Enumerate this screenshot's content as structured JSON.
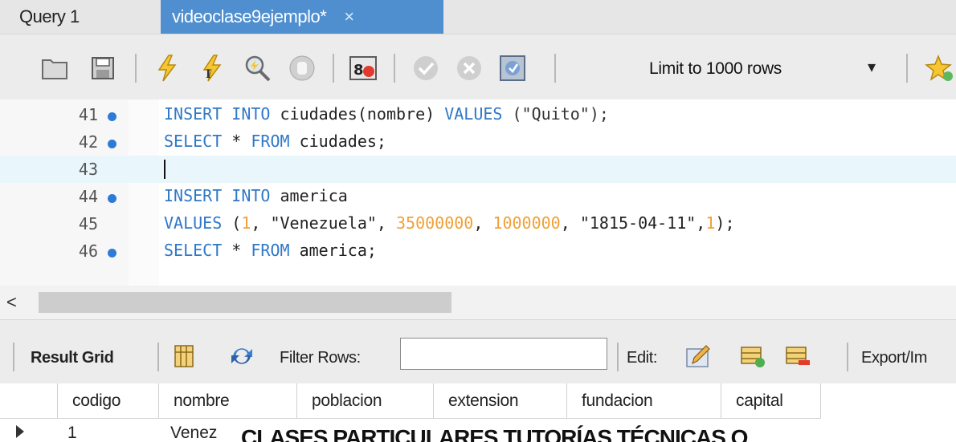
{
  "tabs": [
    {
      "label": "Query 1",
      "active": false
    },
    {
      "label": "videoclase9ejemplo*",
      "active": true
    }
  ],
  "tab_close": "×",
  "toolbar": {
    "limit_label": "Limit to 1000 rows",
    "limit_arrow": "▾"
  },
  "editor": {
    "lines": [
      {
        "num": "41",
        "dot": true
      },
      {
        "num": "42",
        "dot": true
      },
      {
        "num": "43",
        "dot": false
      },
      {
        "num": "44",
        "dot": true
      },
      {
        "num": "45",
        "dot": false
      },
      {
        "num": "46",
        "dot": true
      }
    ],
    "code": {
      "l41a": "INSERT INTO",
      "l41b": " ciudades(nombre) ",
      "l41c": "VALUES",
      "l41d": " (\"Quito\");",
      "l42a": "SELECT",
      "l42b": " * ",
      "l42c": "FROM",
      "l42d": " ciudades;",
      "l44a": "INSERT INTO",
      "l44b": " america",
      "l45a": "VALUES",
      "l45b": " (",
      "l45c": "1",
      "l45d": ", \"Venezuela\", ",
      "l45e": "35000000",
      "l45f": ", ",
      "l45g": "1000000",
      "l45h": ", \"1815-04-11\",",
      "l45i": "1",
      "l45j": ");",
      "l46a": "SELECT",
      "l46b": " * ",
      "l46c": "FROM",
      "l46d": " america;"
    }
  },
  "scroll": {
    "left_arrow": "<"
  },
  "result_toolbar": {
    "result_grid": "Result Grid",
    "filter_rows": "Filter Rows:",
    "edit": "Edit:",
    "export": "Export/Im"
  },
  "grid": {
    "columns": [
      "codigo",
      "nombre",
      "poblacion",
      "extension",
      "fundacion",
      "capital"
    ],
    "row1_codigo": "1",
    "row1_nombre": "Venez"
  },
  "overlay_text": "CLASES PARTICULARES TUTORÍAS TÉCNICAS O",
  "colors": {
    "tab_active": "#4f8fd0",
    "keyword": "#2f78c8",
    "number": "#f0a036",
    "breakpoint_dot": "#2e7bd6"
  }
}
